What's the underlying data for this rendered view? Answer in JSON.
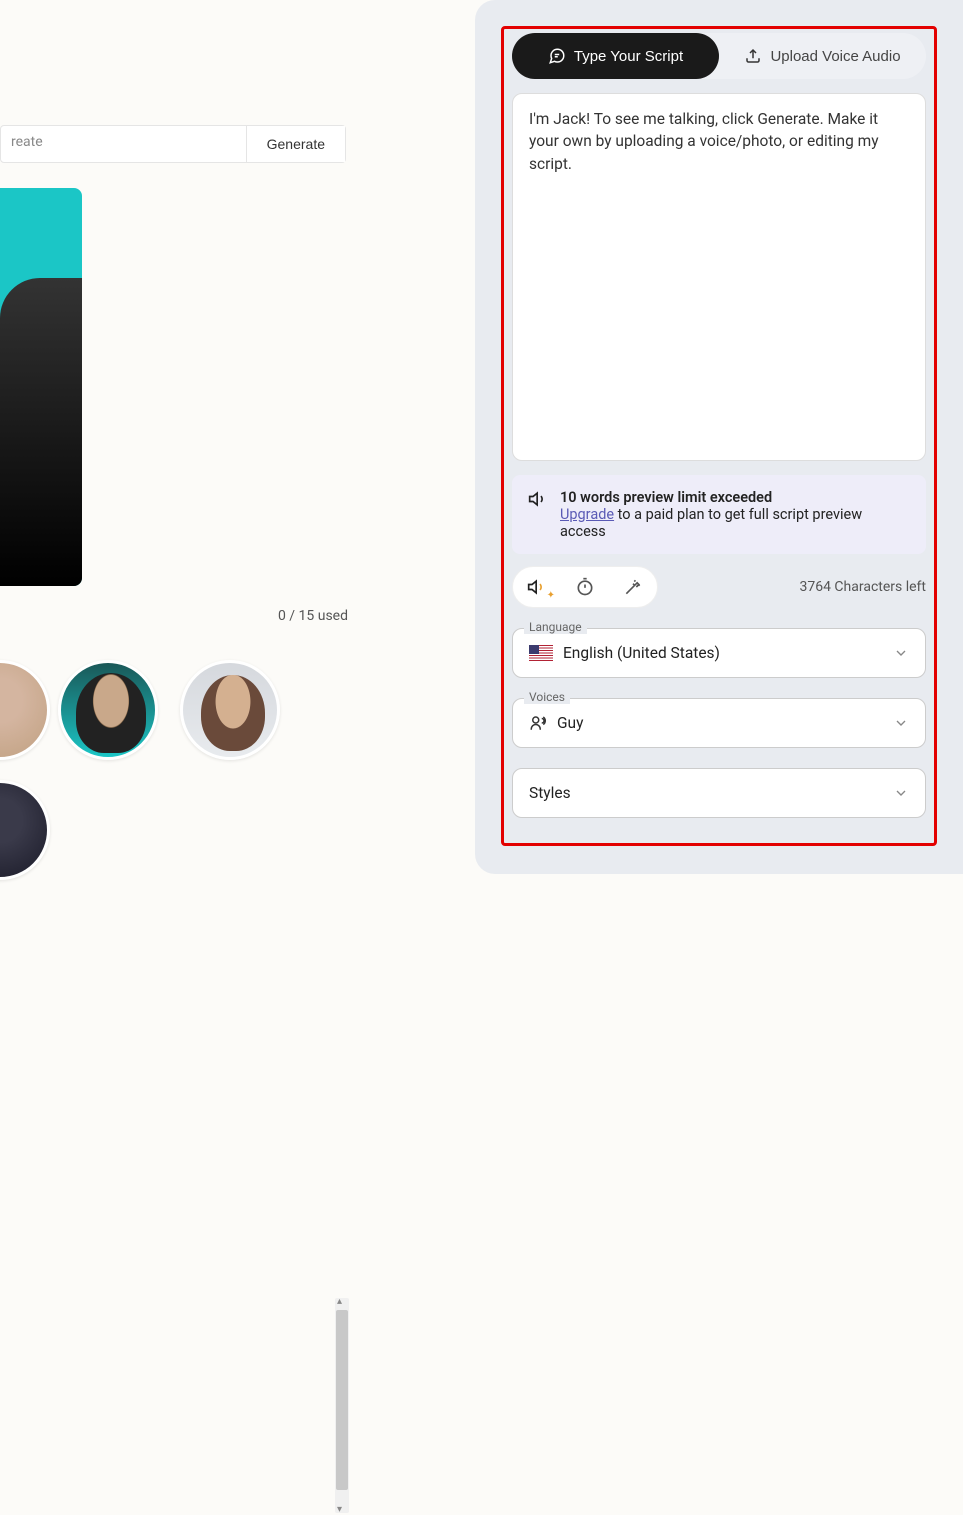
{
  "left": {
    "input_partial": "reate",
    "generate_label": "Generate",
    "usage_text": "0 / 15 used"
  },
  "tabs": {
    "type_script": "Type Your Script",
    "upload_audio": "Upload Voice Audio"
  },
  "script_text": "I'm Jack! To see me talking, click Generate. Make it your own by uploading a voice/photo, or editing my script.",
  "banner": {
    "title": "10 words preview limit exceeded",
    "link": "Upgrade",
    "rest": " to a paid plan to get full script preview access"
  },
  "chars_left": "3764 Characters left",
  "language": {
    "label": "Language",
    "value": "English (United States)"
  },
  "voices": {
    "label": "Voices",
    "value": "Guy"
  },
  "styles": {
    "label": "Styles"
  }
}
